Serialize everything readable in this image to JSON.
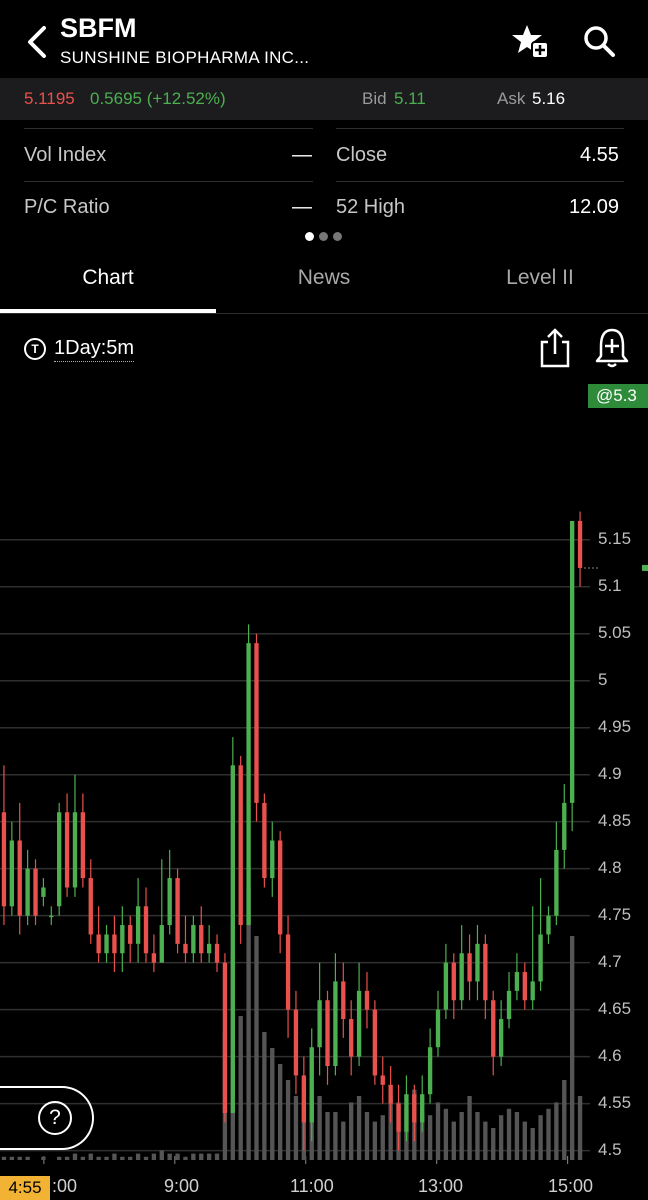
{
  "header": {
    "ticker": "SBFM",
    "company": "SUNSHINE BIOPHARMA INC...",
    "icons": [
      "back-icon",
      "star-plus-icon",
      "search-icon"
    ]
  },
  "quote": {
    "last": "5.1195",
    "change": "0.5695 (+12.52%)",
    "bid_label": "Bid",
    "bid": "5.11",
    "ask_label": "Ask",
    "ask": "5.16"
  },
  "stats": {
    "left": [
      {
        "label": "Vol Index",
        "value": "—"
      },
      {
        "label": "P/C Ratio",
        "value": "—"
      }
    ],
    "right": [
      {
        "label": "Close",
        "value": "4.55"
      },
      {
        "label": "52 High",
        "value": "12.09"
      }
    ],
    "page_dots": 3,
    "active_dot": 0
  },
  "tabs": [
    {
      "label": "Chart",
      "active": true
    },
    {
      "label": "News",
      "active": false
    },
    {
      "label": "Level II",
      "active": false
    }
  ],
  "toolbar": {
    "timeframe": "1Day:5m",
    "timeframe_icon_glyph": "T",
    "icons": [
      "share-icon",
      "alert-bell-icon"
    ]
  },
  "price_badge": "@5.3",
  "help_glyph": "?",
  "time_badge": "4:55",
  "colors": {
    "up": "#4caf50",
    "down": "#e8514d",
    "volume": "#555555",
    "grid": "#2f2f2f",
    "badge_green": "#2e8b3a",
    "time_badge": "#f2b234"
  },
  "chart_data": {
    "type": "candlestick",
    "x_tick_labels": [
      ":00",
      "9:00",
      "11:00",
      "13:00",
      "15:00"
    ],
    "x_ticks_hours": [
      7,
      9,
      11,
      13,
      15
    ],
    "y_tick_labels": [
      "5.15",
      "5.1",
      "5.05",
      "5",
      "4.95",
      "4.9",
      "4.85",
      "4.8",
      "4.75",
      "4.7",
      "4.65",
      "4.6",
      "4.55",
      "4.5"
    ],
    "ylim": [
      4.49,
      5.32
    ],
    "candles": [
      [
        4.86,
        4.76,
        4.91,
        4.74
      ],
      [
        4.76,
        4.83,
        4.85,
        4.75
      ],
      [
        4.83,
        4.75,
        4.87,
        4.73
      ],
      [
        4.75,
        4.8,
        4.82,
        4.74
      ],
      [
        4.8,
        4.75,
        4.81,
        4.74
      ],
      [
        4.77,
        4.78,
        4.79,
        4.76
      ],
      [
        4.75,
        4.75,
        4.76,
        4.74
      ],
      [
        4.76,
        4.86,
        4.87,
        4.75
      ],
      [
        4.86,
        4.78,
        4.88,
        4.77
      ],
      [
        4.78,
        4.86,
        4.9,
        4.77
      ],
      [
        4.86,
        4.79,
        4.88,
        4.78
      ],
      [
        4.79,
        4.73,
        4.81,
        4.72
      ],
      [
        4.73,
        4.71,
        4.76,
        4.7
      ],
      [
        4.71,
        4.73,
        4.74,
        4.7
      ],
      [
        4.73,
        4.71,
        4.75,
        4.69
      ],
      [
        4.71,
        4.74,
        4.76,
        4.69
      ],
      [
        4.74,
        4.72,
        4.75,
        4.7
      ],
      [
        4.72,
        4.76,
        4.79,
        4.7
      ],
      [
        4.76,
        4.71,
        4.78,
        4.7
      ],
      [
        4.71,
        4.7,
        4.73,
        4.69
      ],
      [
        4.7,
        4.74,
        4.81,
        4.7
      ],
      [
        4.74,
        4.79,
        4.82,
        4.73
      ],
      [
        4.79,
        4.72,
        4.8,
        4.71
      ],
      [
        4.72,
        4.71,
        4.75,
        4.7
      ],
      [
        4.71,
        4.74,
        4.75,
        4.7
      ],
      [
        4.74,
        4.71,
        4.76,
        4.7
      ],
      [
        4.71,
        4.72,
        4.74,
        4.7
      ],
      [
        4.72,
        4.7,
        4.73,
        4.69
      ],
      [
        4.7,
        4.54,
        4.71,
        4.53
      ],
      [
        4.54,
        4.91,
        4.94,
        4.54
      ],
      [
        4.91,
        4.74,
        4.92,
        4.72
      ],
      [
        4.74,
        5.04,
        5.06,
        4.74
      ],
      [
        5.04,
        4.87,
        5.05,
        4.85
      ],
      [
        4.87,
        4.79,
        4.88,
        4.78
      ],
      [
        4.79,
        4.83,
        4.85,
        4.77
      ],
      [
        4.83,
        4.73,
        4.84,
        4.71
      ],
      [
        4.73,
        4.65,
        4.75,
        4.62
      ],
      [
        4.65,
        4.58,
        4.67,
        4.56
      ],
      [
        4.58,
        4.53,
        4.6,
        4.5
      ],
      [
        4.53,
        4.61,
        4.63,
        4.51
      ],
      [
        4.61,
        4.66,
        4.7,
        4.58
      ],
      [
        4.66,
        4.59,
        4.67,
        4.57
      ],
      [
        4.59,
        4.68,
        4.71,
        4.58
      ],
      [
        4.68,
        4.64,
        4.7,
        4.62
      ],
      [
        4.64,
        4.6,
        4.66,
        4.58
      ],
      [
        4.6,
        4.67,
        4.7,
        4.59
      ],
      [
        4.67,
        4.65,
        4.69,
        4.63
      ],
      [
        4.65,
        4.58,
        4.66,
        4.57
      ],
      [
        4.58,
        4.57,
        4.6,
        4.55
      ],
      [
        4.57,
        4.55,
        4.59,
        4.53
      ],
      [
        4.55,
        4.52,
        4.57,
        4.5
      ],
      [
        4.52,
        4.56,
        4.58,
        4.51
      ],
      [
        4.56,
        4.53,
        4.57,
        4.51
      ],
      [
        4.53,
        4.56,
        4.58,
        4.52
      ],
      [
        4.56,
        4.61,
        4.63,
        4.55
      ],
      [
        4.61,
        4.65,
        4.67,
        4.6
      ],
      [
        4.65,
        4.7,
        4.72,
        4.64
      ],
      [
        4.7,
        4.66,
        4.71,
        4.64
      ],
      [
        4.66,
        4.71,
        4.74,
        4.65
      ],
      [
        4.71,
        4.68,
        4.73,
        4.66
      ],
      [
        4.68,
        4.72,
        4.74,
        4.66
      ],
      [
        4.72,
        4.66,
        4.73,
        4.64
      ],
      [
        4.66,
        4.6,
        4.67,
        4.58
      ],
      [
        4.6,
        4.64,
        4.66,
        4.59
      ],
      [
        4.64,
        4.67,
        4.69,
        4.63
      ],
      [
        4.67,
        4.69,
        4.71,
        4.66
      ],
      [
        4.69,
        4.66,
        4.7,
        4.65
      ],
      [
        4.66,
        4.68,
        4.76,
        4.65
      ],
      [
        4.68,
        4.73,
        4.79,
        4.67
      ],
      [
        4.73,
        4.75,
        4.76,
        4.72
      ],
      [
        4.75,
        4.82,
        4.85,
        4.74
      ],
      [
        4.82,
        4.87,
        4.89,
        4.8
      ],
      [
        4.87,
        5.17,
        5.17,
        4.84
      ],
      [
        5.17,
        5.12,
        5.18,
        5.1
      ]
    ],
    "volume_relative": [
      0.01,
      0.01,
      0.01,
      0.01,
      0.0,
      0.01,
      0.0,
      0.01,
      0.01,
      0.02,
      0.01,
      0.02,
      0.01,
      0.01,
      0.02,
      0.01,
      0.01,
      0.02,
      0.01,
      0.02,
      0.03,
      0.02,
      0.02,
      0.01,
      0.02,
      0.02,
      0.02,
      0.02,
      0.4,
      0.65,
      0.45,
      0.85,
      0.7,
      0.4,
      0.35,
      0.3,
      0.25,
      0.2,
      0.18,
      0.22,
      0.2,
      0.15,
      0.15,
      0.12,
      0.18,
      0.2,
      0.15,
      0.12,
      0.14,
      0.2,
      0.18,
      0.16,
      0.22,
      0.15,
      0.14,
      0.18,
      0.16,
      0.12,
      0.15,
      0.2,
      0.15,
      0.12,
      0.1,
      0.14,
      0.16,
      0.15,
      0.12,
      0.1,
      0.14,
      0.16,
      0.18,
      0.25,
      0.7,
      0.2
    ]
  }
}
